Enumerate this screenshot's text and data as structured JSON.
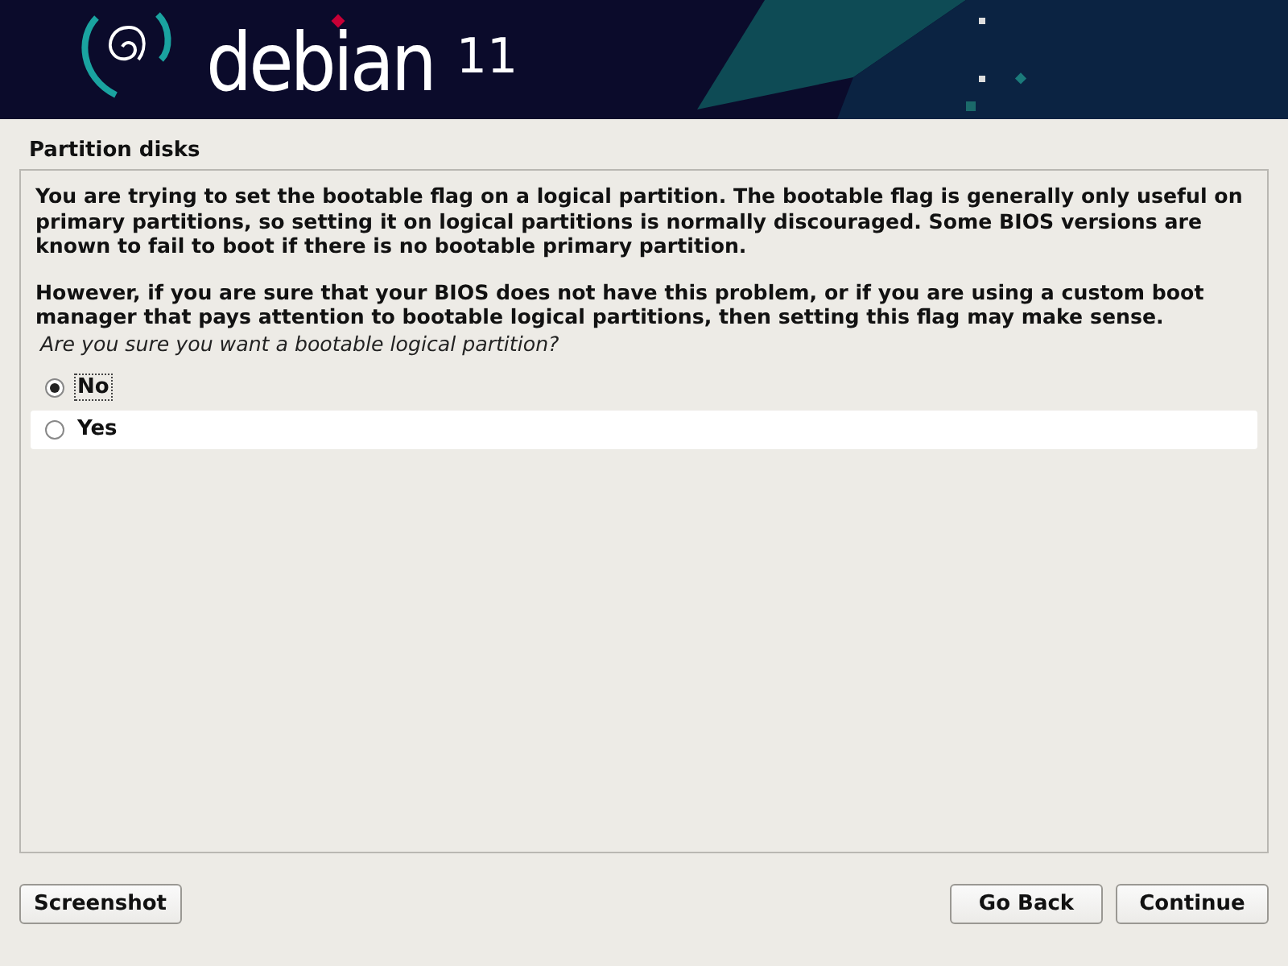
{
  "banner": {
    "name": "debian",
    "version": "11"
  },
  "title": "Partition disks",
  "paragraphs": [
    "You are trying to set the bootable flag on a logical partition. The bootable flag is generally only useful on primary partitions, so setting it on logical partitions is normally discouraged. Some BIOS versions are known to fail to boot if there is no bootable primary partition.",
    "However, if you are sure that your BIOS does not have this problem, or if you are using a custom boot manager that pays attention to bootable logical partitions, then setting this flag may make sense."
  ],
  "question": "Are you sure you want a bootable logical partition?",
  "options": [
    {
      "label": "No",
      "selected": true,
      "highlighted": false
    },
    {
      "label": "Yes",
      "selected": false,
      "highlighted": true
    }
  ],
  "buttons": [
    {
      "label": "Screenshot",
      "kind": "left"
    },
    {
      "label": "Go Back",
      "kind": "right"
    },
    {
      "label": "Continue",
      "kind": "right"
    }
  ]
}
